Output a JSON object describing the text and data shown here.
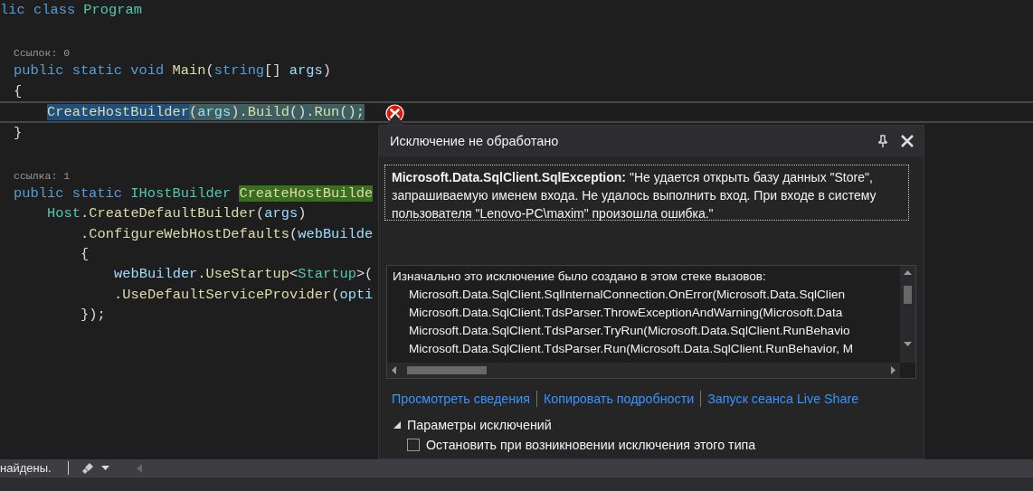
{
  "editor": {
    "lines": [
      {
        "kind": "code",
        "tokens": [
          {
            "text": "lic class ",
            "kind": "keyword"
          },
          {
            "text": "Program",
            "kind": "type"
          }
        ],
        "children": [
          {
            "kind": "blank"
          },
          {
            "kind": "lens",
            "text": "Ссылок: 0"
          },
          {
            "kind": "code",
            "tokens": [
              {
                "text": "public static void ",
                "kind": "keyword"
              },
              {
                "text": "Main",
                "kind": "method"
              },
              {
                "text": "(",
                "kind": "plain"
              },
              {
                "text": "string",
                "kind": "keyword"
              },
              {
                "text": "[] ",
                "kind": "plain"
              },
              {
                "text": "args",
                "kind": "param"
              },
              {
                "text": ")",
                "kind": "plain"
              }
            ]
          },
          {
            "kind": "code",
            "tokens": [
              {
                "text": "{",
                "kind": "plain"
              }
            ],
            "children": [
              {
                "kind": "code",
                "current": true,
                "error": true,
                "tokens": [
                  {
                    "text": "CreateHostBuilder",
                    "kind": "method",
                    "selected": true
                  },
                  {
                    "text": "(",
                    "kind": "plain",
                    "selected": false
                  },
                  {
                    "text": "args",
                    "kind": "param",
                    "selected": false
                  },
                  {
                    "text": ").",
                    "kind": "plain",
                    "selected": false
                  },
                  {
                    "text": "Build",
                    "kind": "method",
                    "selected": false
                  },
                  {
                    "text": "().",
                    "kind": "plain",
                    "selected": false
                  },
                  {
                    "text": "Run",
                    "kind": "method",
                    "selected": false
                  },
                  {
                    "text": "();",
                    "kind": "plain",
                    "selected": false
                  }
                ]
              }
            ]
          },
          {
            "kind": "code",
            "tokens": [
              {
                "text": "}",
                "kind": "plain"
              }
            ]
          },
          {
            "kind": "blank"
          },
          {
            "kind": "lens",
            "text": "ссылка: 1"
          },
          {
            "kind": "code",
            "tokens": [
              {
                "text": "public static ",
                "kind": "keyword"
              },
              {
                "text": "IHostBuilder ",
                "kind": "type"
              },
              {
                "text": "CreateHostBuilde",
                "kind": "method",
                "highlighted": true
              }
            ],
            "children": [
              {
                "kind": "code",
                "tokens": [
                  {
                    "text": "Host",
                    "kind": "type"
                  },
                  {
                    "text": ".",
                    "kind": "plain"
                  },
                  {
                    "text": "CreateDefaultBuilder",
                    "kind": "method"
                  },
                  {
                    "text": "(",
                    "kind": "plain"
                  },
                  {
                    "text": "args",
                    "kind": "param"
                  },
                  {
                    "text": ")",
                    "kind": "plain"
                  }
                ],
                "children": [
                  {
                    "kind": "code",
                    "tokens": [
                      {
                        "text": ".",
                        "kind": "plain"
                      },
                      {
                        "text": "ConfigureWebHostDefaults",
                        "kind": "method"
                      },
                      {
                        "text": "(",
                        "kind": "plain"
                      },
                      {
                        "text": "webBuilde",
                        "kind": "param"
                      }
                    ]
                  },
                  {
                    "kind": "code",
                    "tokens": [
                      {
                        "text": "{",
                        "kind": "plain"
                      }
                    ],
                    "children": [
                      {
                        "kind": "code",
                        "tokens": [
                          {
                            "text": "webBuilder",
                            "kind": "param"
                          },
                          {
                            "text": ".",
                            "kind": "plain"
                          },
                          {
                            "text": "UseStartup",
                            "kind": "method"
                          },
                          {
                            "text": "<",
                            "kind": "plain"
                          },
                          {
                            "text": "Startup",
                            "kind": "type"
                          },
                          {
                            "text": ">(",
                            "kind": "plain"
                          }
                        ]
                      },
                      {
                        "kind": "code",
                        "tokens": [
                          {
                            "text": ".",
                            "kind": "plain"
                          },
                          {
                            "text": "UseDefaultServiceProvider",
                            "kind": "method"
                          },
                          {
                            "text": "(",
                            "kind": "plain"
                          },
                          {
                            "text": "opti",
                            "kind": "param"
                          }
                        ]
                      }
                    ]
                  },
                  {
                    "kind": "code",
                    "tokens": [
                      {
                        "text": "});",
                        "kind": "plain"
                      }
                    ]
                  }
                ]
              }
            ]
          }
        ]
      }
    ]
  },
  "exception": {
    "title": "Исключение не обработано",
    "message": "**Microsoft.Data.SqlClient.SqlException:** \"Не удается открыть базу данных \"Store\", запрашиваемую именем входа. Не удалось выполнить вход. При входе в систему пользователя \"Lenovo-PC\\maxim\" произошла ошибка.\"",
    "stack_heading": "Изначально это исключение было создано в этом стеке вызовов:",
    "stack": [
      "Microsoft.Data.SqlClient.SqlInternalConnection.OnError(Microsoft.Data.SqlClien",
      "Microsoft.Data.SqlClient.TdsParser.ThrowExceptionAndWarning(Microsoft.Data",
      "Microsoft.Data.SqlClient.TdsParser.TryRun(Microsoft.Data.SqlClient.RunBehavio",
      "Microsoft.Data.SqlClient.TdsParser.Run(Microsoft.Data.SqlClient.RunBehavior, M"
    ],
    "links": [
      "Просмотреть сведения",
      "Копировать подробности",
      "Запуск сеанса Live Share"
    ],
    "settings": {
      "label": "Параметры исключений",
      "expanded": true,
      "options": [
        {
          "label": "Остановить при возникновении исключения этого типа",
          "checked": false
        }
      ]
    }
  },
  "status_bar": {
    "text": "найдены."
  }
}
